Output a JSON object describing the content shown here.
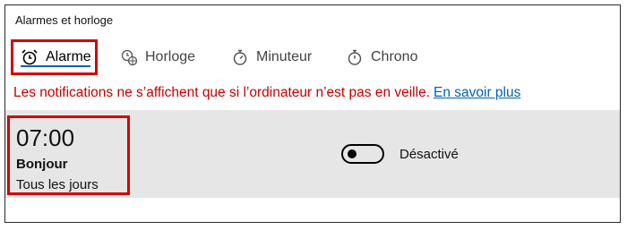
{
  "window": {
    "title": "Alarmes et horloge"
  },
  "tabs": [
    {
      "label": "Alarme",
      "icon": "alarm-clock-icon",
      "active": true
    },
    {
      "label": "Horloge",
      "icon": "world-clock-icon",
      "active": false
    },
    {
      "label": "Minuteur",
      "icon": "timer-icon",
      "active": false
    },
    {
      "label": "Chrono",
      "icon": "stopwatch-icon",
      "active": false
    }
  ],
  "notice": {
    "text": "Les notifications ne s’affichent que si l’ordinateur n’est pas en veille.",
    "link": "En savoir plus"
  },
  "alarm": {
    "time": "07:00",
    "name": "Bonjour",
    "repeat": "Tous les jours",
    "toggle_label": "Désactivé",
    "enabled": false
  },
  "colors": {
    "highlight": "#d60000",
    "accent": "#0063b1",
    "notice": "#c50000",
    "row_bg": "#e6e6e6"
  }
}
